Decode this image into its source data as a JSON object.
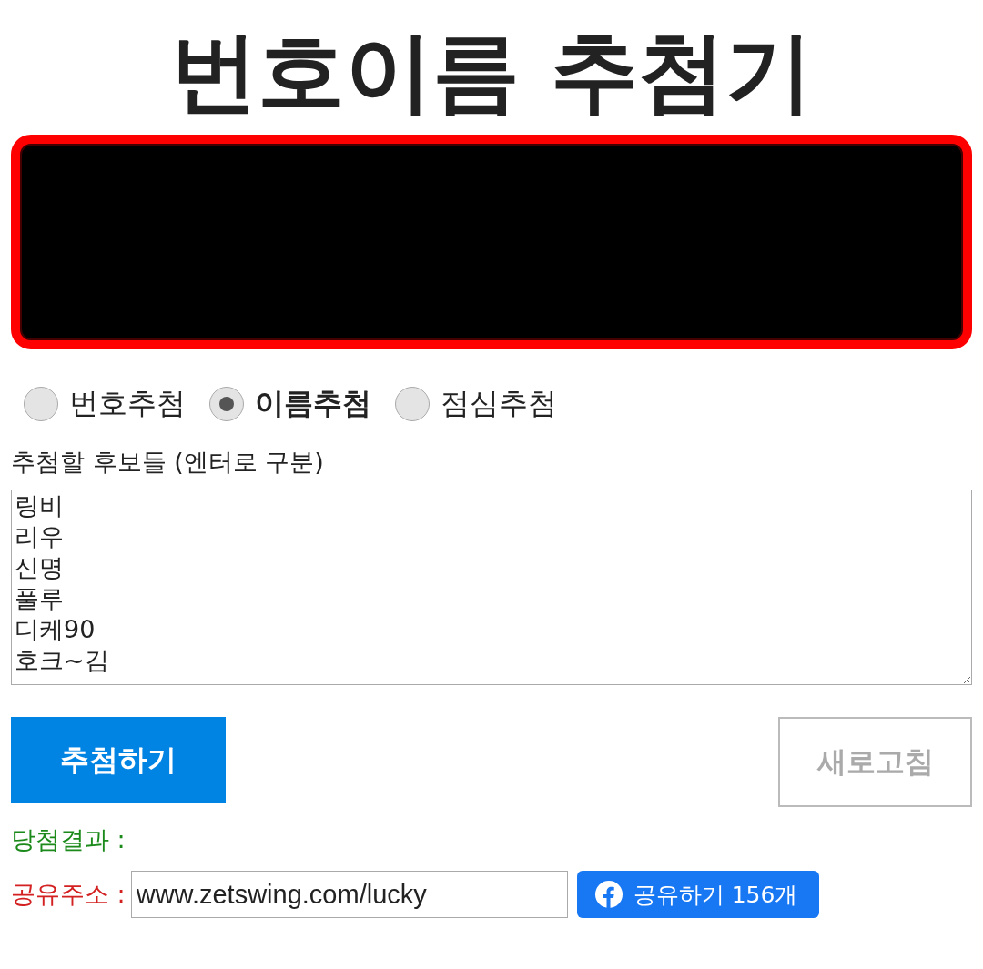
{
  "title": "번호이름 추첨기",
  "modes": [
    {
      "label": "번호추첨",
      "selected": false
    },
    {
      "label": "이름추첨",
      "selected": true
    },
    {
      "label": "점심추첨",
      "selected": false
    }
  ],
  "candidates_label": "추첨할 후보들 (엔터로 구분)",
  "candidates": [
    "링비",
    "리우",
    "신명",
    "풀루",
    "디케90",
    "호크~김"
  ],
  "buttons": {
    "draw": "추첨하기",
    "refresh": "새로고침"
  },
  "result_label": "당첨결과 :",
  "share": {
    "label": "공유주소 :",
    "url": "www.zetswing.com/lucky",
    "button": "공유하기 156개"
  }
}
